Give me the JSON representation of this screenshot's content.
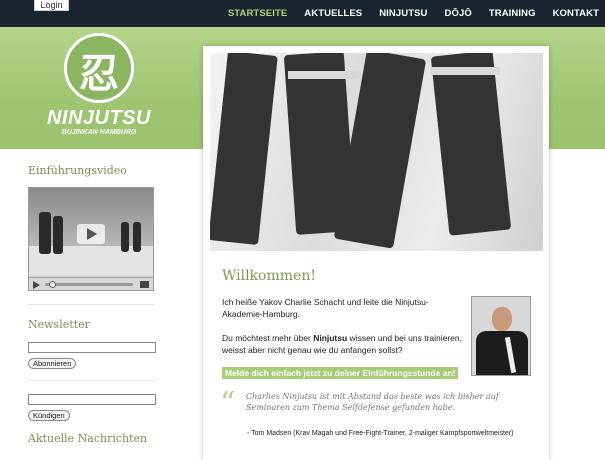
{
  "topbar": {
    "login_label": "Login",
    "nav": [
      {
        "label": "STARTSEITE",
        "active": true
      },
      {
        "label": "AKTUELLES",
        "active": false
      },
      {
        "label": "NINJUTSU",
        "active": false
      },
      {
        "label": "DŌJŌ",
        "active": false
      },
      {
        "label": "TRAINING",
        "active": false
      },
      {
        "label": "KONTAKT",
        "active": false
      }
    ]
  },
  "logo": {
    "kanji": "忍",
    "word": "NINJUTSU",
    "subtitle": "BUJINKAN HAMBURG"
  },
  "sidebar": {
    "video_title": "Einführungsvideo",
    "newsletter_title": "Newsletter",
    "subscribe_label": "Abonnieren",
    "unsubscribe_label": "Kündigen",
    "news_title": "Aktuelle Nachrichten"
  },
  "main": {
    "welcome": "Willkommen!",
    "intro": "Ich heiße Yakov Charlie Schacht und leite die Ninjutsu-Akademie-Hamburg.",
    "question_pre": "Du möchtest mehr über ",
    "question_bold": "Ninjutsu",
    "question_post": " wissen und bei uns trainieren, weisst aber nicht genau wie du anfangen sollst?",
    "cta": "Melde dich einfach jetzt zu deiner Einführungsstunde an!",
    "quote": "Charlies Ninjutsu ist mit Abstand das beste was ich bisher auf Seminaren zum Thema Selfdefense gefunden habe.",
    "quote_author": "- Tom Madsen (Krav Magah und Free-Fight-Trainer, 2-maliger Kampfsportweltmeister)"
  },
  "colors": {
    "topbar": "#1a2430",
    "header_green": "#9fc573",
    "accent_green": "#7d9a52",
    "nav_active": "#a8d37a"
  }
}
